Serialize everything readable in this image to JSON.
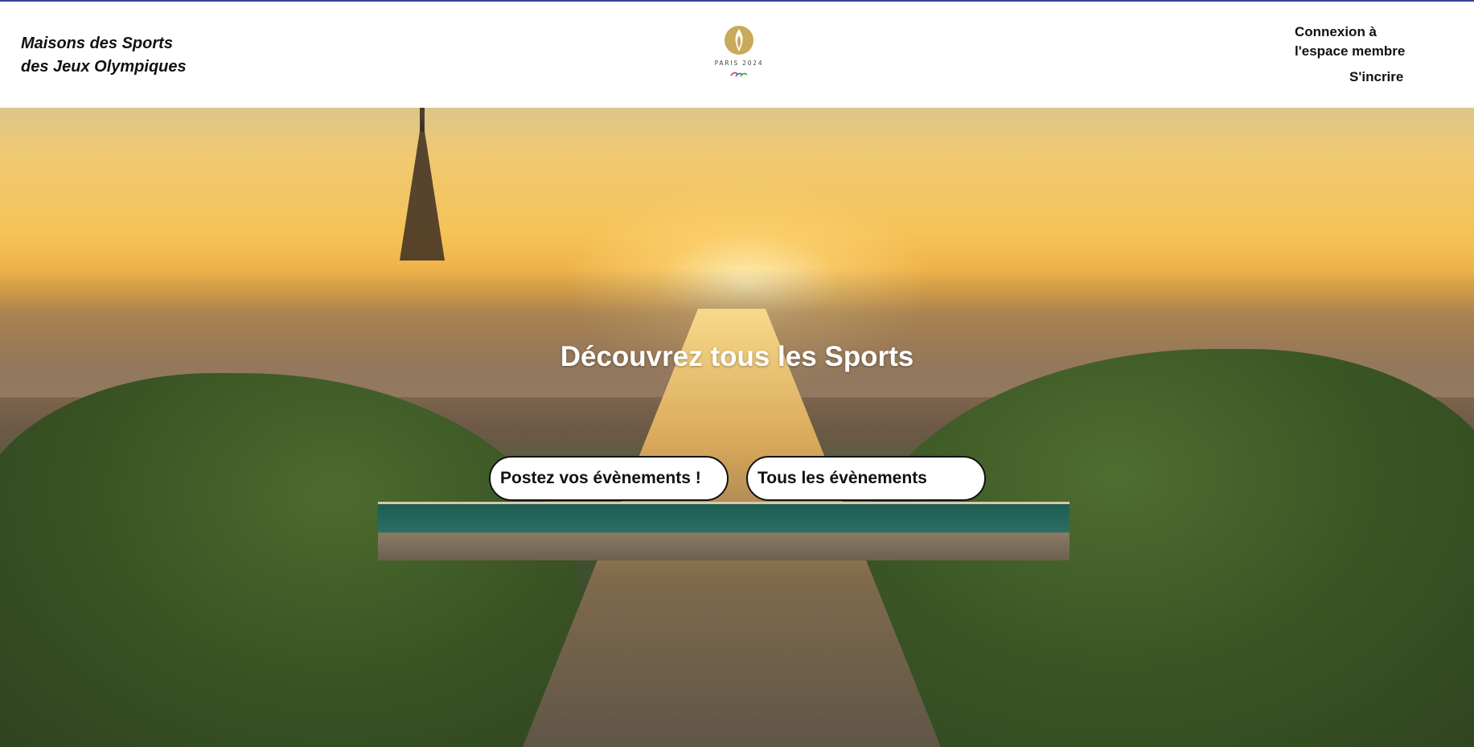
{
  "header": {
    "brand_line1": "Maisons des Sports",
    "brand_line2": "des Jeux Olympiques",
    "logo_text": "PARIS 2024",
    "login_label": "Connexion à l'espace membre",
    "signup_label": "S'incrire"
  },
  "hero": {
    "title": "Découvrez tous les Sports",
    "post_button": "Postez vos évènements !",
    "all_events_button": "Tous les évènements"
  },
  "colors": {
    "top_border": "#3b3f8f",
    "logo_gold": "#c9a95a",
    "button_bg": "#ffffff",
    "text": "#111111"
  },
  "icons": {
    "logo": "paris-2024-paralympic-logo"
  }
}
